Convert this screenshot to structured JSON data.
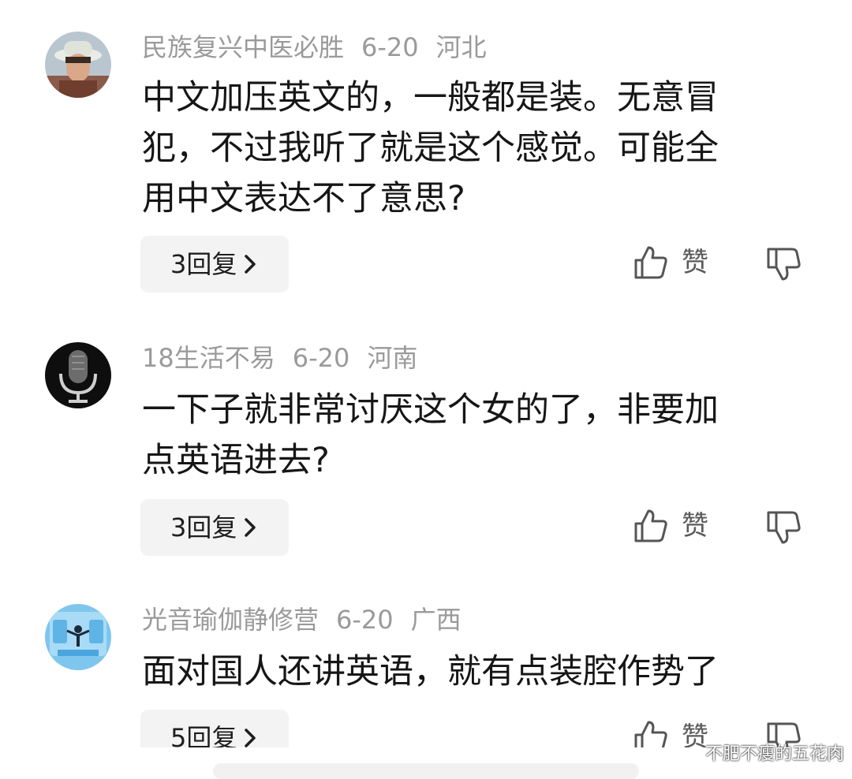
{
  "comments": [
    {
      "user": "民族复兴中医必胜",
      "date": "6-20",
      "location": "河北",
      "lines": [
        "中文加压英文的，一般都是装。无意冒",
        "犯，不过我听了就是这个感觉。可能全",
        "用中文表达不了意思?"
      ],
      "reply_label": "3回复",
      "like_label": "赞",
      "avatar_icon": "person-hat-avatar"
    },
    {
      "user": "18生活不易",
      "date": "6-20",
      "location": "河南",
      "lines": [
        "一下子就非常讨厌这个女的了，非要加",
        "点英语进去?"
      ],
      "reply_label": "3回复",
      "like_label": "赞",
      "avatar_icon": "microphone-avatar"
    },
    {
      "user": "光音瑜伽静修营",
      "date": "6-20",
      "location": "广西",
      "lines": [
        "面对国人还讲英语，就有点装腔作势了"
      ],
      "reply_label": "5回复",
      "like_label": "赞",
      "avatar_icon": "yoga-avatar"
    }
  ],
  "watermark": "不肥不瘦的五花肉",
  "colors": {
    "meta": "#9a9a9a",
    "text": "#161616",
    "reply_bg": "#f3f3f3",
    "icon": "#555555"
  }
}
